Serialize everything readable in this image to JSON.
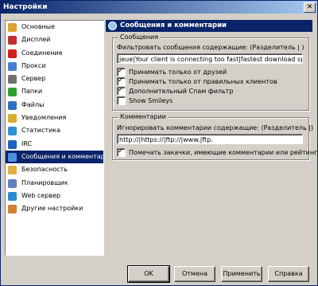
{
  "window": {
    "title": "Настройки",
    "close_glyph": "✕"
  },
  "sidebar": {
    "items": [
      {
        "label": "Основные",
        "icon": "gear-icon",
        "color": "#e0a030"
      },
      {
        "label": "Дисплей",
        "icon": "display-icon",
        "color": "#c03030"
      },
      {
        "label": "Соединение",
        "icon": "connection-icon",
        "color": "#d02020"
      },
      {
        "label": "Прокси",
        "icon": "proxy-icon",
        "color": "#4a7fd0"
      },
      {
        "label": "Сервер",
        "icon": "server-icon",
        "color": "#707070"
      },
      {
        "label": "Папки",
        "icon": "folder-icon",
        "color": "#30a030"
      },
      {
        "label": "Файлы",
        "icon": "files-icon",
        "color": "#3070c0"
      },
      {
        "label": "Уведомления",
        "icon": "notifications-icon",
        "color": "#d8b030"
      },
      {
        "label": "Статистика",
        "icon": "statistics-icon",
        "color": "#3090d0"
      },
      {
        "label": "IRC",
        "icon": "irc-icon",
        "color": "#2060c0"
      },
      {
        "label": "Сообщения и комментарии",
        "icon": "messages-icon",
        "color": "#4a90e0"
      },
      {
        "label": "Безопасность",
        "icon": "security-icon",
        "color": "#e0b040"
      },
      {
        "label": "Планировщик",
        "icon": "scheduler-icon",
        "color": "#6080c0"
      },
      {
        "label": "Web сервер",
        "icon": "web-server-icon",
        "color": "#2a8ad0"
      },
      {
        "label": "Другие настройки",
        "icon": "other-settings-icon",
        "color": "#d08030"
      }
    ],
    "active_index": 10
  },
  "panel": {
    "title": "Сообщения и комментарии",
    "messages": {
      "legend": "Сообщения",
      "filter_label": "Фильтровать сообщения содержащие: (Разделитель | )",
      "filter_value": "jeue|Your client is connecting too fast|fastest download speed",
      "checkboxes": [
        {
          "label": "Принимать только от друзей",
          "checked": true
        },
        {
          "label": "Принимать только от правильных клиентов",
          "checked": true
        },
        {
          "label": "Дополнительный Спам фильтр",
          "checked": true
        },
        {
          "label": "Show Smileys",
          "checked": false
        }
      ]
    },
    "comments": {
      "legend": "Комментарии",
      "ignore_label": "Игнорировать комментарии содержащие: (Разделитель |)",
      "ignore_value": "http://|https://|ftp://|www.|ftp.",
      "mark_label": "Помечать закачки, имеющие комментарии или рейтинг",
      "mark_checked": true
    }
  },
  "buttons": {
    "ok": "OK",
    "cancel": "Отмена",
    "apply": "Применить",
    "help": "Справка"
  }
}
